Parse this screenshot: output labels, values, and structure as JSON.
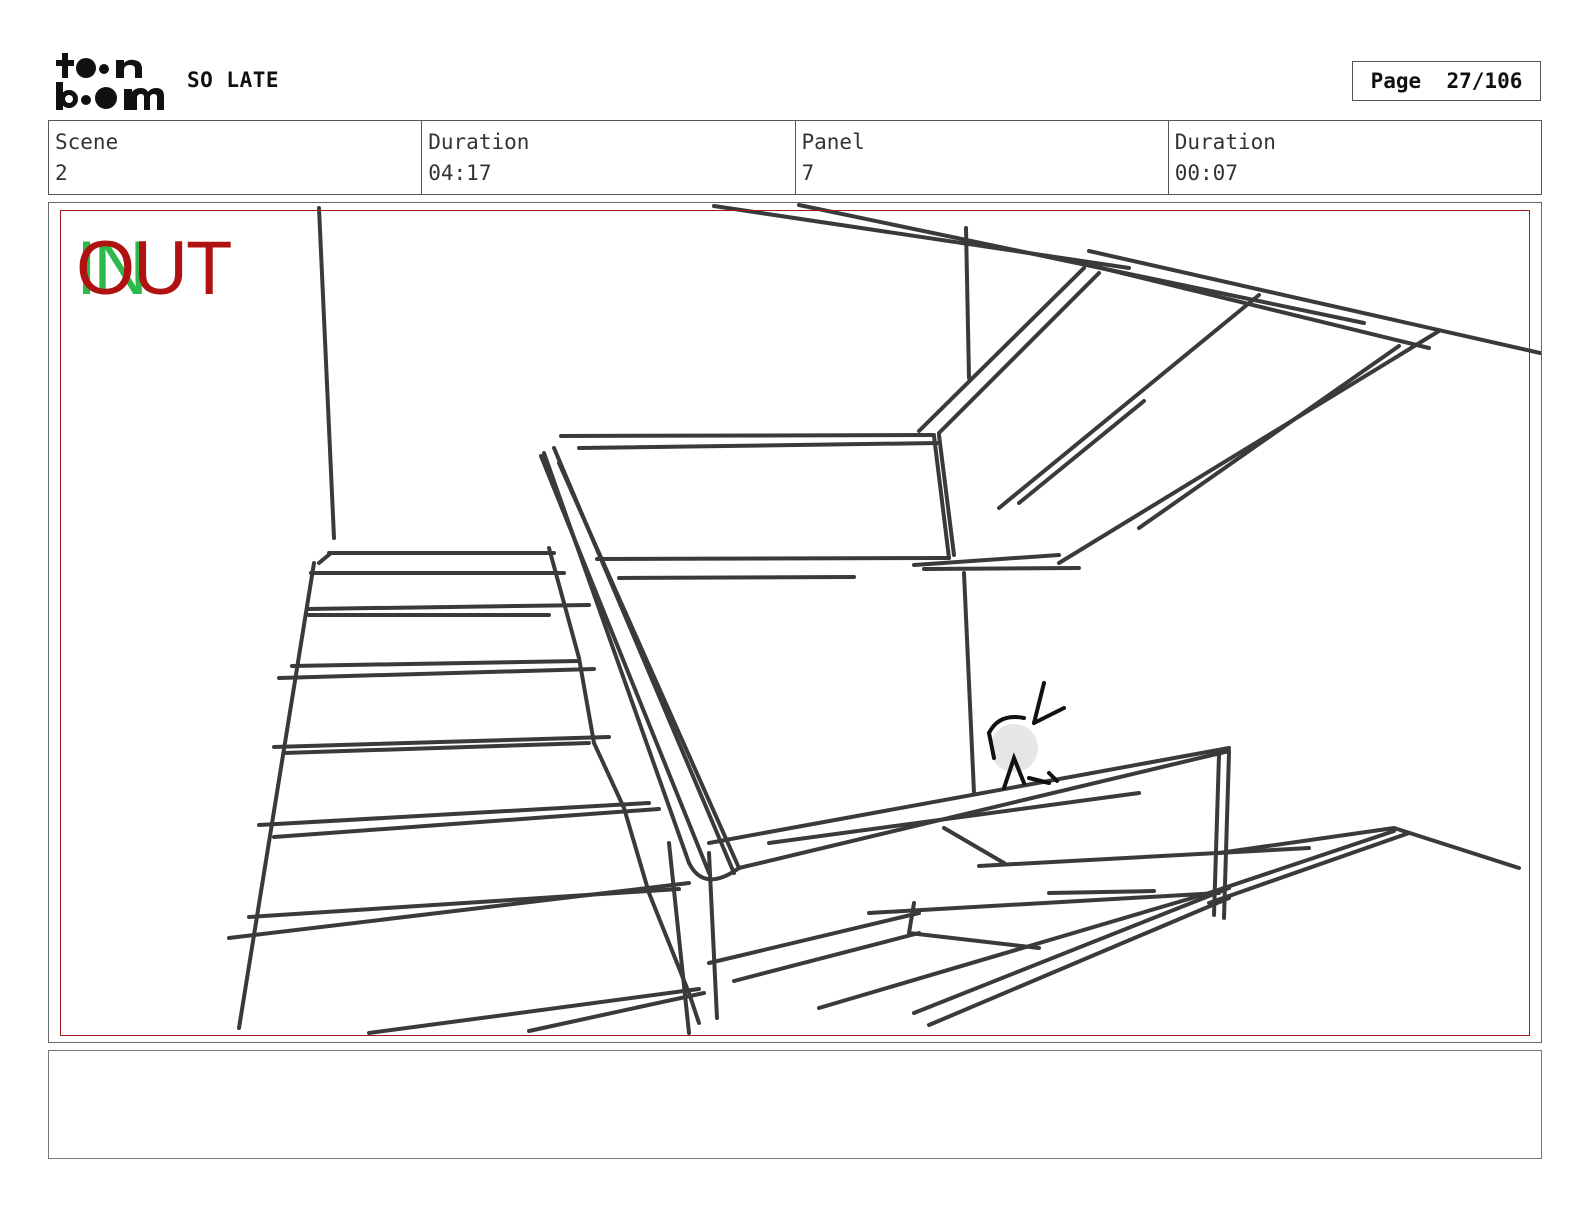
{
  "header": {
    "logo": "toon boom",
    "project_title": "SO LATE",
    "page_label": "Page",
    "page_value": "27/106"
  },
  "info": {
    "scene_label": "Scene",
    "scene_value": "2",
    "scene_duration_label": "Duration",
    "scene_duration_value": "04:17",
    "panel_label": "Panel",
    "panel_value": "7",
    "panel_duration_label": "Duration",
    "panel_duration_value": "00:07"
  },
  "panel": {
    "in_label": "IN",
    "out_label": "OUT",
    "sketch_description_icon": "staircase-sketch"
  },
  "notes": {
    "text": ""
  },
  "colors": {
    "safe_frame": "#a31b1b",
    "in_label": "#2db84b",
    "out_label": "#b01212",
    "sketch_line": "#3a3a3a"
  }
}
